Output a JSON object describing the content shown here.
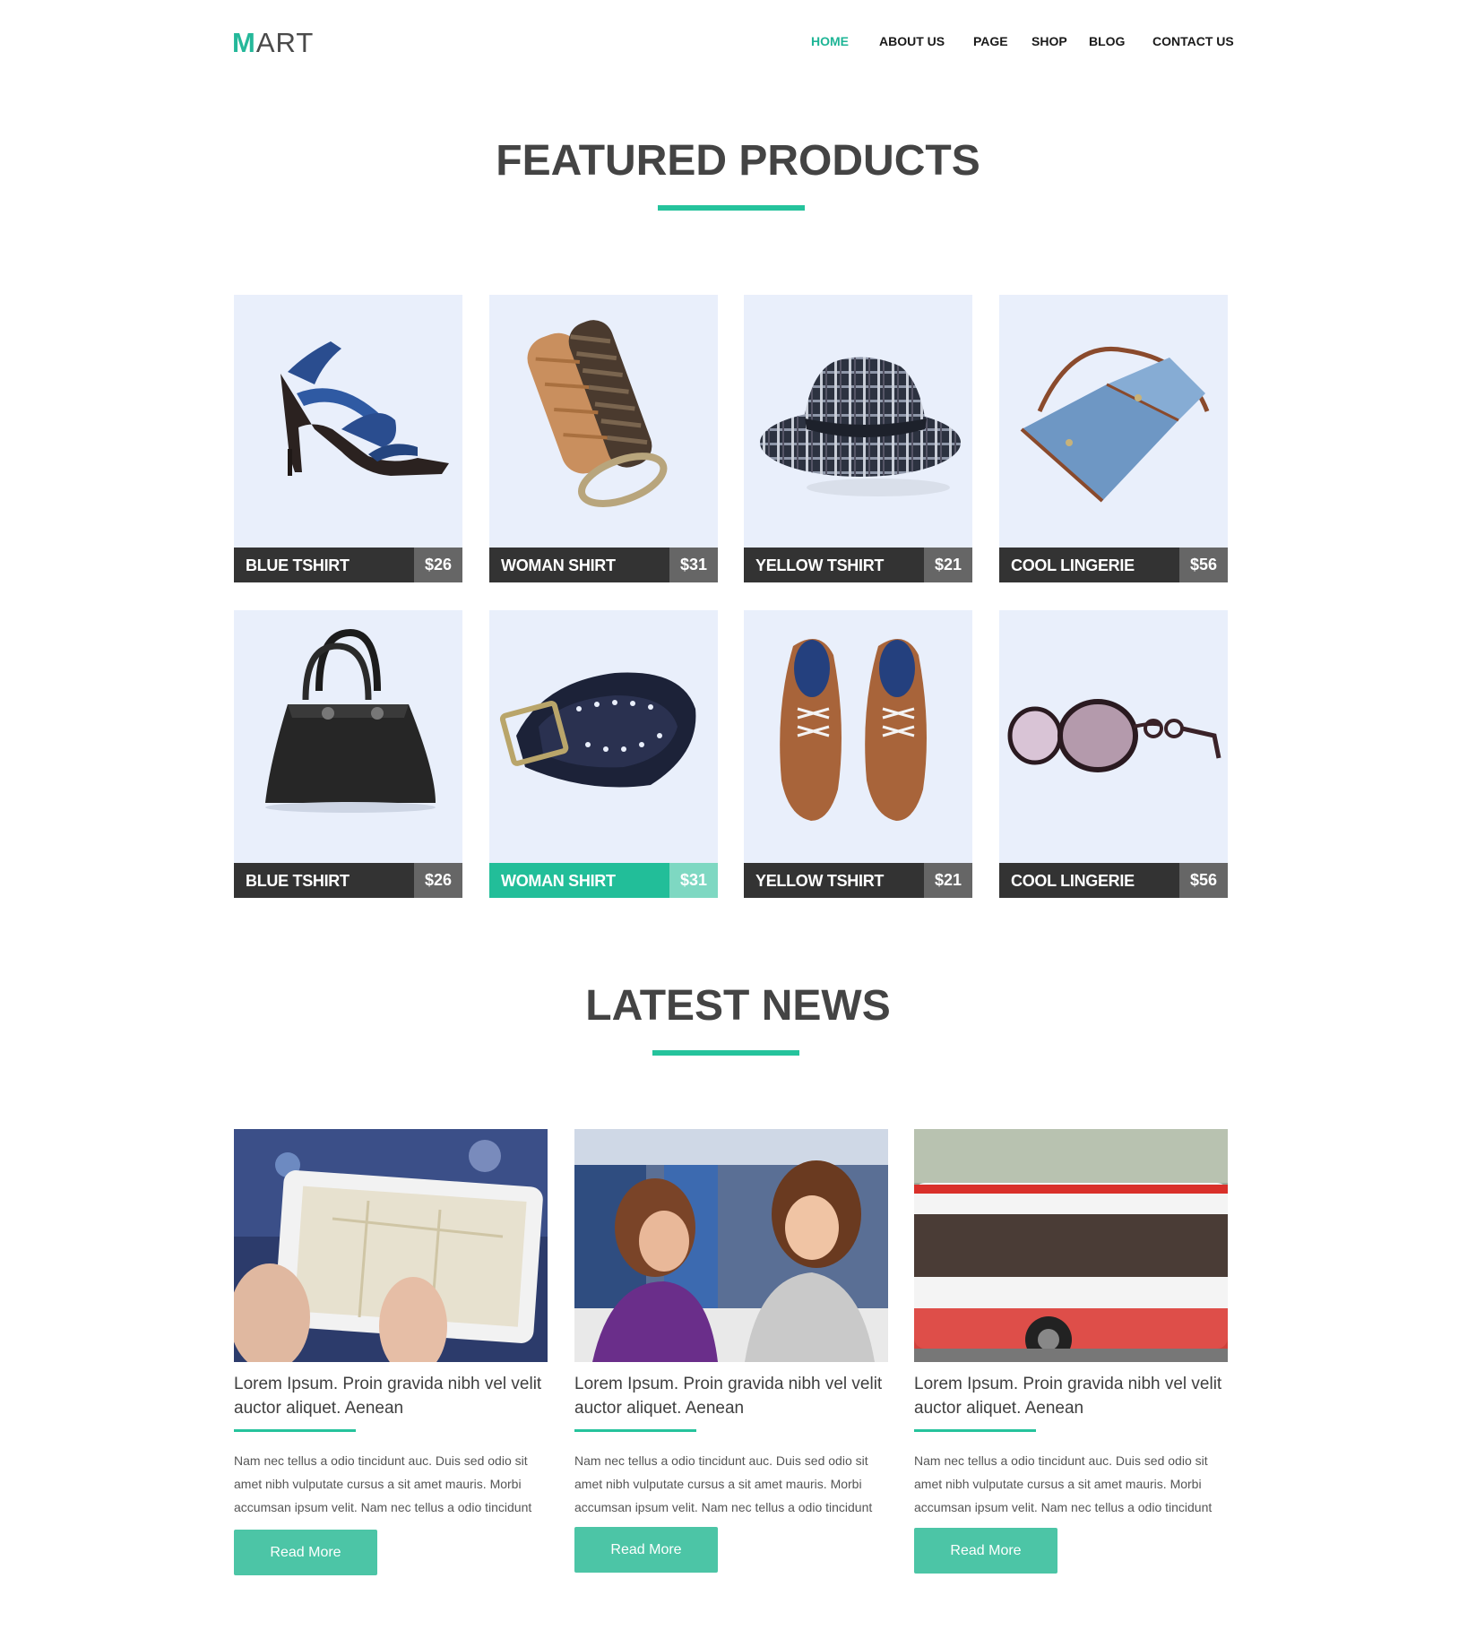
{
  "header": {
    "logo_m": "M",
    "logo_rest": "ART",
    "nav": [
      "HOME",
      "ABOUT US",
      "PAGE",
      "SHOP",
      "BLOG",
      "CONTACT US"
    ],
    "active_nav": "HOME"
  },
  "featured": {
    "title": "FEATURED PRODUCTS",
    "products": [
      {
        "name": "BLUE TSHIRT",
        "price": "$26",
        "icon": "high-heel-sandal-image"
      },
      {
        "name": "WOMAN SHIRT",
        "price": "$31",
        "icon": "braided-belt-image"
      },
      {
        "name": "YELLOW TSHIRT",
        "price": "$21",
        "icon": "plaid-fedora-hat-image"
      },
      {
        "name": "COOL LINGERIE",
        "price": "$56",
        "icon": "denim-shoulder-bag-image"
      },
      {
        "name": "BLUE TSHIRT",
        "price": "$26",
        "icon": "black-handbag-image"
      },
      {
        "name": "WOMAN SHIRT",
        "price": "$31",
        "icon": "perforated-belt-image",
        "highlight": true
      },
      {
        "name": "YELLOW TSHIRT",
        "price": "$21",
        "icon": "leather-shoes-image"
      },
      {
        "name": "COOL LINGERIE",
        "price": "$56",
        "icon": "sunglasses-image"
      }
    ]
  },
  "news": {
    "title": "LATEST NEWS",
    "items": [
      {
        "title": "Lorem Ipsum. Proin gravida nibh vel velit auctor aliquet. Aenean",
        "text": "Nam nec tellus a odio tincidunt auc. Duis sed odio sit amet nibh vulputate cursus a sit amet mauris. Morbi accumsan ipsum velit. Nam nec tellus a odio tincidunt",
        "button": "Read More",
        "icon": "tablet-map-photo"
      },
      {
        "title": "Lorem Ipsum. Proin gravida nibh vel velit auctor aliquet. Aenean",
        "text": "Nam nec tellus a odio tincidunt auc. Duis sed odio sit amet nibh vulputate cursus a sit amet mauris. Morbi accumsan ipsum velit. Nam nec tellus a odio tincidunt",
        "button": "Read More",
        "icon": "students-library-photo"
      },
      {
        "title": "Lorem Ipsum. Proin gravida nibh vel velit auctor aliquet. Aenean",
        "text": "Nam nec tellus a odio tincidunt auc. Duis sed odio sit amet nibh vulputate cursus a sit amet mauris. Morbi accumsan ipsum velit. Nam nec tellus a odio tincidunt",
        "button": "Read More",
        "icon": "city-bus-photo"
      }
    ]
  },
  "colors": {
    "accent": "#25c39c",
    "dark_bar": "#333333",
    "price_box": "#666666",
    "card_bg": "#e9effb"
  }
}
